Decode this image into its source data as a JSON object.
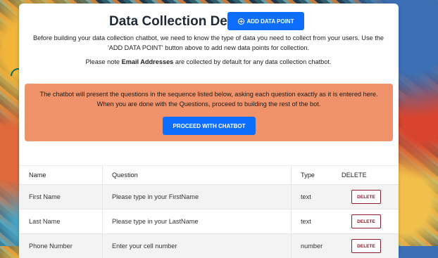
{
  "header": {
    "title": "Data Collection Details",
    "add_button_label": "ADD DATA POINT",
    "add_button_icon": "plus-circle-icon"
  },
  "intro": {
    "text": "Before building your data collection chatbot, we need to know the type of data you need to collect from your users. Use the 'ADD DATA POINT' button above to add new data points for collection.",
    "note_prefix": "Please note ",
    "note_bold": "Email Addresses",
    "note_suffix": " are collected by default for any data collection chatbot."
  },
  "banner": {
    "line1": "The chatbot will present the questions in the sequence listed below, asking each question exactly as it is entered here.",
    "line2": "When you are done with the Questions, proceed to building the rest of the bot.",
    "proceed_label": "PROCEED WITH CHATBOT"
  },
  "table": {
    "columns": [
      "Name",
      "Question",
      "Type",
      "DELETE"
    ],
    "delete_label": "DELETE",
    "rows": [
      {
        "name": "First Name",
        "question": "Please type in your FirstName",
        "type": "text"
      },
      {
        "name": "Last Name",
        "question": "Please type in your LastName",
        "type": "text"
      },
      {
        "name": "Phone Number",
        "question": "Enter your cell number",
        "type": "number"
      }
    ]
  },
  "colors": {
    "primary": "#0d6efd",
    "banner": "#f0936a",
    "delete": "#8b1a2b"
  }
}
